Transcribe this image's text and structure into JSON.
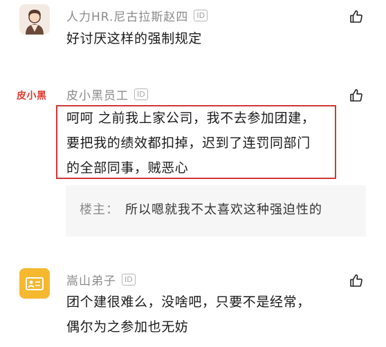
{
  "comments": [
    {
      "username": "人力HR.尼古拉斯赵四",
      "id_badge": "ID",
      "lines": [
        "好讨厌这样的强制规定"
      ]
    },
    {
      "username": "皮小黑员工",
      "id_badge": "ID",
      "avatar_text": "皮小黑",
      "lines": [
        "呵呵  之前我上家公司，我不去参加团建，",
        "要把我的绩效都扣掉，迟到了连罚同部门",
        "的全部同事，贼恶心"
      ],
      "reply": {
        "label": "楼主：",
        "text": "所以嗯就我不太喜欢这种强迫性的"
      }
    },
    {
      "username": "嵩山弟子",
      "id_badge": "ID",
      "lines": [
        "团个建很难么，没啥吧，只要不是经常，",
        "偶尔为之参加也无妨"
      ]
    }
  ],
  "icons": {
    "avatar_1": "worker-avatar-icon",
    "avatar_3": "id-card-avatar-icon",
    "like": "thumbs-up-icon"
  },
  "colors": {
    "highlight_border": "#d33535",
    "brand_red": "#e0392f",
    "avatar_1_bg": "#f3ebe3",
    "avatar_3_bg": "#f5b82e"
  }
}
